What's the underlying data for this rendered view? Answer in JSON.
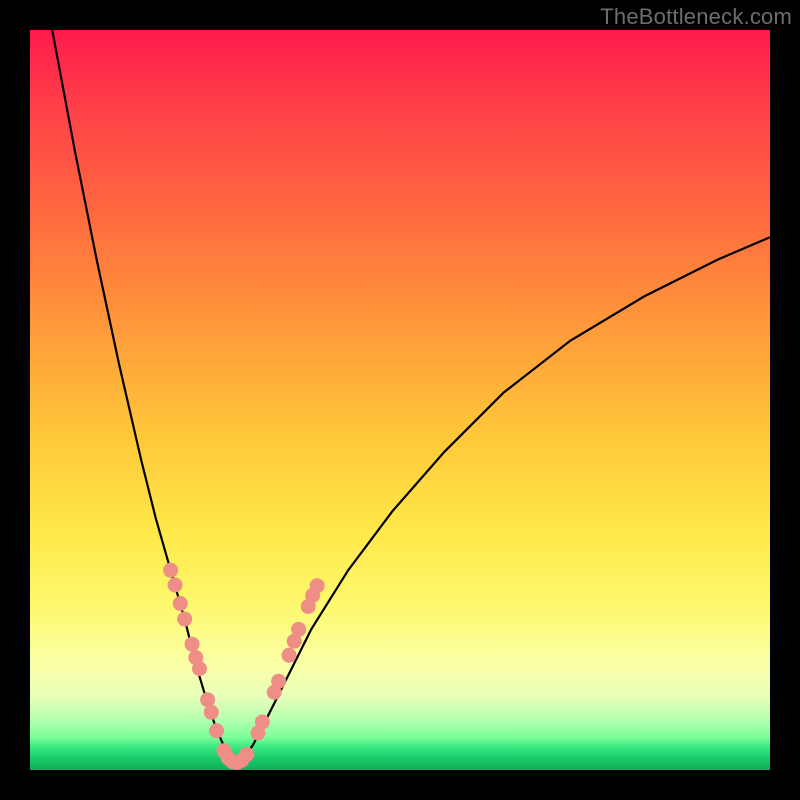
{
  "watermark": "TheBottleneck.com",
  "chart_data": {
    "type": "line",
    "title": "",
    "xlabel": "",
    "ylabel": "",
    "xlim": [
      0,
      100
    ],
    "ylim": [
      0,
      100
    ],
    "note": "Bottleneck-style V-curve over red-to-green vertical gradient; salmon markers cluster near the minimum. No axis ticks or labels visible.",
    "series": [
      {
        "name": "left-branch",
        "x": [
          3,
          6,
          9,
          12,
          15,
          17,
          19,
          21,
          22.5,
          24,
          25.2,
          26.3,
          27.2,
          27.8
        ],
        "y": [
          100,
          84,
          69,
          55,
          42,
          34,
          27,
          20,
          14,
          9,
          5.5,
          3,
          1.5,
          1
        ]
      },
      {
        "name": "right-branch",
        "x": [
          28.2,
          29,
          30.2,
          32,
          34.5,
          38,
          43,
          49,
          56,
          64,
          73,
          83,
          93,
          100
        ],
        "y": [
          1,
          1.7,
          3.5,
          7,
          12,
          19,
          27,
          35,
          43,
          51,
          58,
          64,
          69,
          72
        ]
      }
    ],
    "markers": {
      "color": "#ef8d87",
      "points": [
        {
          "x": 19.0,
          "y": 27.0
        },
        {
          "x": 19.6,
          "y": 25.0
        },
        {
          "x": 20.3,
          "y": 22.5
        },
        {
          "x": 20.9,
          "y": 20.4
        },
        {
          "x": 21.9,
          "y": 17.0
        },
        {
          "x": 22.4,
          "y": 15.2
        },
        {
          "x": 22.9,
          "y": 13.7
        },
        {
          "x": 24.0,
          "y": 9.5
        },
        {
          "x": 24.5,
          "y": 7.8
        },
        {
          "x": 25.2,
          "y": 5.3
        },
        {
          "x": 26.2,
          "y": 2.6
        },
        {
          "x": 26.8,
          "y": 1.6
        },
        {
          "x": 27.4,
          "y": 1.1
        },
        {
          "x": 28.0,
          "y": 1.0
        },
        {
          "x": 28.6,
          "y": 1.3
        },
        {
          "x": 29.3,
          "y": 2.1
        },
        {
          "x": 30.8,
          "y": 5.0
        },
        {
          "x": 31.4,
          "y": 6.5
        },
        {
          "x": 33.0,
          "y": 10.5
        },
        {
          "x": 33.6,
          "y": 12.0
        },
        {
          "x": 35.0,
          "y": 15.5
        },
        {
          "x": 35.7,
          "y": 17.4
        },
        {
          "x": 36.3,
          "y": 19.0
        },
        {
          "x": 37.6,
          "y": 22.1
        },
        {
          "x": 38.2,
          "y": 23.6
        },
        {
          "x": 38.8,
          "y": 24.9
        }
      ]
    }
  }
}
